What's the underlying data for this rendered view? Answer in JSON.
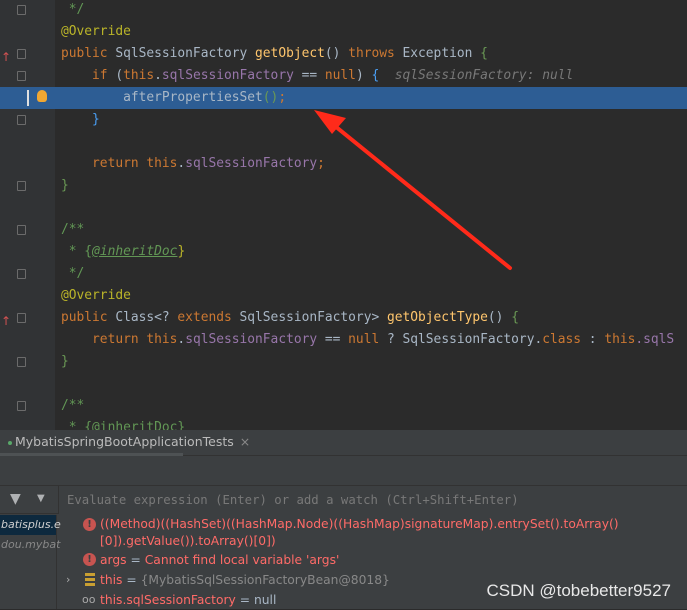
{
  "editor": {
    "lines": [
      {
        "gutter": "fold",
        "tokens": [
          [
            " */",
            "c"
          ]
        ]
      },
      {
        "tokens": [
          [
            "@Override",
            "a"
          ]
        ]
      },
      {
        "gutter": "override-fold",
        "tokens": [
          [
            "public ",
            "k"
          ],
          [
            "SqlSessionFactory ",
            "t"
          ],
          [
            "getObject",
            "m"
          ],
          [
            "() ",
            "t"
          ],
          [
            "throws ",
            "k"
          ],
          [
            "Exception ",
            "t"
          ],
          [
            "{",
            "bg"
          ]
        ]
      },
      {
        "gutter": "fold",
        "tokens": [
          [
            "    if ",
            "k"
          ],
          [
            "(",
            "t"
          ],
          [
            "this",
            "k"
          ],
          [
            ".",
            "t"
          ],
          [
            "sqlSessionFactory",
            "f"
          ],
          [
            " == ",
            "t"
          ],
          [
            "null",
            "k"
          ],
          [
            ") ",
            "t"
          ],
          [
            "{",
            "bb"
          ],
          [
            "  sqlSessionFactory: null",
            "h"
          ]
        ]
      },
      {
        "gutter": "breakpoint",
        "selected": true,
        "tokens": [
          [
            "        afterPropertiesSet",
            "t"
          ],
          [
            "()",
            "bg"
          ],
          [
            ";",
            "k"
          ]
        ]
      },
      {
        "gutter": "fold",
        "tokens": [
          [
            "    }",
            "bb"
          ]
        ]
      },
      {
        "tokens": []
      },
      {
        "tokens": [
          [
            "    return ",
            "k"
          ],
          [
            "this",
            "k"
          ],
          [
            ".",
            "t"
          ],
          [
            "sqlSessionFactory",
            "f"
          ],
          [
            ";",
            "k"
          ]
        ]
      },
      {
        "gutter": "fold",
        "tokens": [
          [
            "}",
            "bg"
          ]
        ]
      },
      {
        "tokens": []
      },
      {
        "gutter": "fold",
        "tokens": [
          [
            "/**",
            "c"
          ]
        ]
      },
      {
        "tokens": [
          [
            " * ",
            "c"
          ],
          [
            "{",
            "c"
          ],
          [
            "@inheritDoc",
            "cu"
          ],
          [
            "}",
            "a"
          ]
        ]
      },
      {
        "gutter": "fold",
        "tokens": [
          [
            " */",
            "c"
          ]
        ]
      },
      {
        "tokens": [
          [
            "@Override",
            "a"
          ]
        ]
      },
      {
        "gutter": "override-fold",
        "tokens": [
          [
            "public ",
            "k"
          ],
          [
            "Class<? ",
            "t"
          ],
          [
            "extends ",
            "k"
          ],
          [
            "SqlSessionFactory> ",
            "t"
          ],
          [
            "getObjectType",
            "m"
          ],
          [
            "() ",
            "t"
          ],
          [
            "{",
            "bg"
          ]
        ]
      },
      {
        "tokens": [
          [
            "    return ",
            "k"
          ],
          [
            "this",
            "k"
          ],
          [
            ".",
            "t"
          ],
          [
            "sqlSessionFactory",
            "f"
          ],
          [
            " == ",
            "t"
          ],
          [
            "null",
            "k"
          ],
          [
            " ? ",
            "t"
          ],
          [
            "SqlSessionFactory",
            "t"
          ],
          [
            ".",
            "t"
          ],
          [
            "class",
            "k"
          ],
          [
            " : ",
            "t"
          ],
          [
            "this",
            "k"
          ],
          [
            ".sqlS",
            "f"
          ]
        ]
      },
      {
        "gutter": "fold",
        "tokens": [
          [
            "}",
            "bg"
          ]
        ]
      },
      {
        "tokens": []
      },
      {
        "gutter": "fold",
        "tokens": [
          [
            "/**",
            "c"
          ]
        ]
      },
      {
        "tokens": [
          [
            " * {@inheritDoc}",
            "c"
          ]
        ]
      }
    ]
  },
  "annotation": {
    "arrow_color": "#ff2a1a"
  },
  "debug": {
    "tab_label": "MybatisSpringBootApplicationTests",
    "tab_close": "×",
    "watch_placeholder": "Evaluate expression (Enter) or add a watch (Ctrl+Shift+Enter)",
    "frames": [
      "batisplus.e",
      "dou.mybat"
    ],
    "variables": [
      {
        "icon": "error-icon",
        "name": "((Method)((HashSet)((HashMap.Node)((HashMap)signatureMap).entrySet().toArray()[0]).getValue()).toArray()[0])",
        "sep": "",
        "value": ""
      },
      {
        "icon": "error-icon",
        "name": "args",
        "sep": " = ",
        "value": "Cannot find local variable 'args'"
      },
      {
        "icon": "field-icon",
        "expandable": true,
        "name": "this",
        "sep": " = ",
        "value": "{MybatisSqlSessionFactoryBean@8018}"
      },
      {
        "icon": "watch-glasses-icon",
        "name": "this.sqlSessionFactory",
        "sep": " = ",
        "value": "null"
      }
    ]
  },
  "watermark": "CSDN @tobebetter9527"
}
